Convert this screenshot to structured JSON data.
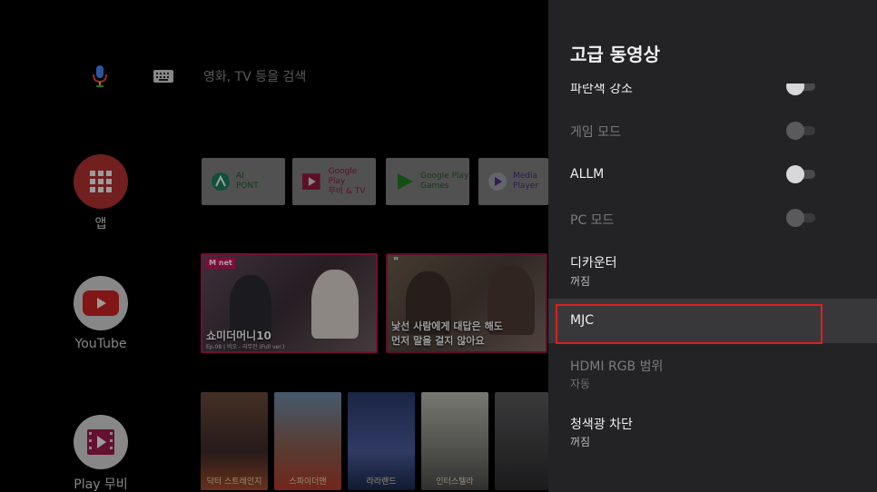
{
  "search": {
    "placeholder": "영화, TV 등을 검색",
    "mic_icon": "mic-icon",
    "keyboard_icon": "keyboard-icon"
  },
  "rail": {
    "apps_label": "앱",
    "youtube_label": "YouTube",
    "play_movies_label": "Play 무비"
  },
  "apps_row": [
    {
      "name": "AI\nPONT",
      "icon": "ai-pont-icon"
    },
    {
      "name": "Google Play\n무비 & TV",
      "icon": "play-movies-icon"
    },
    {
      "name": "Google Play\nGames",
      "icon": "play-games-icon"
    },
    {
      "name": "Media\nPlayer",
      "icon": "media-player-icon"
    }
  ],
  "videos_row": [
    {
      "badge": "M net",
      "title": "쇼미더머니10",
      "subtitle": "Ep.08 | 비오 - 리무진 (Full ver.)"
    },
    {
      "quote": "\"",
      "title_line1": "낯선 사람에게 대답은 해도",
      "title_line2": "먼저 말을 걸지 않아요"
    }
  ],
  "posters_row": [
    {
      "caption": "닥터 스트레인지"
    },
    {
      "caption": "스파이더맨"
    },
    {
      "caption": "라라랜드"
    },
    {
      "caption": "인터스텔라"
    },
    {
      "caption": ""
    }
  ],
  "panel": {
    "title": "고급 동영상",
    "items": [
      {
        "label": "파란색 강조",
        "has_toggle": true,
        "toggle_on": false,
        "disabled": false
      },
      {
        "label": "게임 모드",
        "has_toggle": true,
        "toggle_on": false,
        "disabled": true
      },
      {
        "label": "ALLM",
        "has_toggle": true,
        "toggle_on": false,
        "disabled": false
      },
      {
        "label": "PC 모드",
        "has_toggle": true,
        "toggle_on": false,
        "disabled": true
      },
      {
        "label": "디카운터",
        "value": "꺼짐",
        "disabled": false
      },
      {
        "label": "MJC",
        "disabled": false,
        "focused": true
      },
      {
        "label": "HDMI RGB 범위",
        "value": "자동",
        "disabled": true
      },
      {
        "label": "청색광 차단",
        "value": "꺼짐",
        "disabled": false
      }
    ]
  },
  "colors": {
    "panel_bg": "#232325",
    "focus_border": "#e01e1e",
    "apps_button": "#b03030"
  }
}
